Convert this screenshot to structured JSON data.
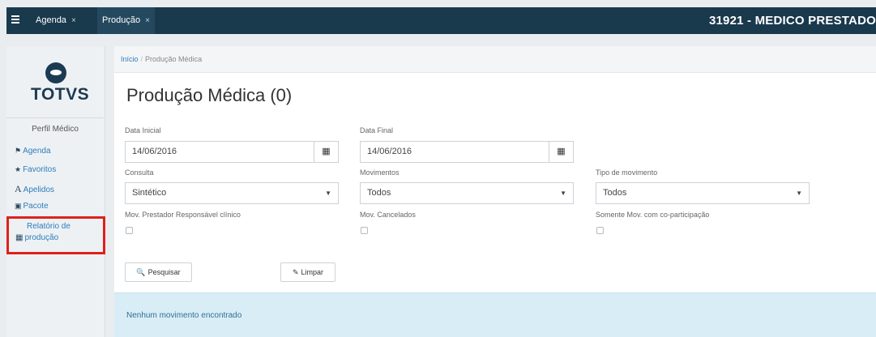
{
  "tabs": [
    {
      "label": "Agenda",
      "close": "×"
    },
    {
      "label": "Produção",
      "close": "×"
    }
  ],
  "user": {
    "label": "31921 - MEDICO PRESTADO"
  },
  "sidebar": {
    "logo_text": "TOTVS",
    "profile_title": "Perfil Médico",
    "items": [
      {
        "label": "Agenda",
        "icon": "home-icon"
      },
      {
        "label": "Favoritos",
        "icon": "star-icon"
      },
      {
        "label": "Apelidos",
        "icon": "font-icon"
      },
      {
        "label": "Pacote",
        "icon": "briefcase-icon"
      }
    ],
    "report": {
      "line1": "Relatório de",
      "line2": "produção",
      "icon": "table-icon",
      "highlight_color": "#e0201c"
    }
  },
  "breadcrumb": {
    "home": "Início",
    "separator": "/",
    "current": "Produção Médica"
  },
  "page": {
    "title": "Produção Médica (0)"
  },
  "form": {
    "data_inicial": {
      "label": "Data Inicial",
      "value": "14/06/2016"
    },
    "data_final": {
      "label": "Data Final",
      "value": "14/06/2016"
    },
    "consulta": {
      "label": "Consulta",
      "value": "Sintético"
    },
    "movimentos": {
      "label": "Movimentos",
      "value": "Todos"
    },
    "tipo_movimento": {
      "label": "Tipo de movimento",
      "value": "Todos"
    },
    "mov_prestador": {
      "label": "Mov. Prestador Responsável clínico",
      "checked": false
    },
    "mov_cancelados": {
      "label": "Mov. Cancelados",
      "checked": false
    },
    "somente_mov": {
      "label": "Somente Mov. com co-participação",
      "checked": false
    }
  },
  "buttons": {
    "pesquisar": "Pesquisar",
    "limpar": "Limpar"
  },
  "alert": {
    "message": "Nenhum movimento encontrado"
  },
  "colors": {
    "topbar": "#19394d",
    "link": "#2c7dbd",
    "alert_bg": "#d9edf7",
    "alert_text": "#31708f"
  }
}
